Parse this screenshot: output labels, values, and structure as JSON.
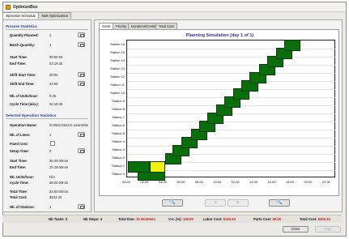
{
  "window": {
    "title": "OptimizeBox"
  },
  "main_tabs": [
    {
      "label": "Operation Schedule",
      "active": true
    },
    {
      "label": "Task Optimization",
      "active": false
    }
  ],
  "process_statistics": {
    "header": "Process Statistics",
    "rows": [
      {
        "label": "Quantity Planned:",
        "value": "1",
        "button": true
      },
      {
        "label": "Batch Quantity:",
        "value": "1",
        "button": true
      },
      {
        "label": "Start Time:",
        "value": "00:00:00"
      },
      {
        "label": "End Time:",
        "value": "02:19:45"
      },
      {
        "label": "Shift Start Time:",
        "value": "00:00",
        "button": true
      },
      {
        "label": "Shift End Time:",
        "value": "24:00",
        "button": true
      },
      {
        "label": "Nb. of Units/hour:",
        "value": "0.25"
      },
      {
        "label": "Cycle Time (min.):",
        "value": "02:19:45"
      }
    ]
  },
  "selected_operation": {
    "header": "Selected Operation Statistics",
    "rows": [
      {
        "label": "Operation Name:",
        "value": "O-0002 Electric assemble"
      },
      {
        "label": "Nb. of Lines:",
        "value": "1",
        "button": true
      },
      {
        "label": "Fixed Cost:",
        "value": "",
        "checkbox": true
      },
      {
        "label": "Setup Time:",
        "value": "0",
        "button": true
      },
      {
        "label": "Start Time:",
        "value": "25:49.00min"
      },
      {
        "label": "End Time:",
        "value": "1h 29.00min"
      },
      {
        "label": "Nb. Units/hour:",
        "value": "N/A"
      },
      {
        "label": "Cycle Time:",
        "value": "06:00.00min"
      },
      {
        "label": "Total Time:",
        "value": "24:00.00min"
      },
      {
        "label": "Total Cost:",
        "value": "$103.33"
      },
      {
        "label": "Nb. of Stations:",
        "value": "1",
        "button": true
      }
    ]
  },
  "chart_tabs": [
    {
      "label": "Gantt",
      "active": true
    },
    {
      "label": "Priority",
      "active": false
    },
    {
      "label": "Durations/Costs",
      "active": false
    },
    {
      "label": "Total Cost",
      "active": false
    }
  ],
  "chart_data": {
    "type": "bar",
    "title": "Planning Simulation (day 1 of 1)",
    "y_categories": [
      "Station 0",
      "Station 1",
      "Station 2",
      "Station 3",
      "Station 4",
      "Station 5",
      "Station 6",
      "Station 7",
      "Station 8",
      "Station 9",
      "Station 10",
      "Station 11",
      "Station 12",
      "Station 13",
      "Station 14",
      "Station 15",
      "Station 16"
    ],
    "x_ticks": [
      "00:00",
      "02:00",
      "04:00",
      "06:00",
      "08:00",
      "10:00",
      "12:00",
      "14:00",
      "16:00",
      "18:00",
      "20:00",
      "22:00"
    ],
    "x_range_hours": [
      0,
      23
    ],
    "bars": [
      {
        "row": 0,
        "start": 1.2,
        "end": 4.2,
        "color": "#0a6e0a"
      },
      {
        "row": 1,
        "start": 0.1,
        "end": 2.5,
        "color": "#0a6e0a"
      },
      {
        "row": 1,
        "start": 2.5,
        "end": 4.2,
        "color": "#f2f20e"
      },
      {
        "row": 2,
        "start": 4.2,
        "end": 6.0,
        "color": "#0a6e0a"
      },
      {
        "row": 3,
        "start": 5.0,
        "end": 6.9,
        "color": "#0a6e0a"
      },
      {
        "row": 4,
        "start": 6.0,
        "end": 7.8,
        "color": "#0a6e0a"
      },
      {
        "row": 5,
        "start": 7.0,
        "end": 8.8,
        "color": "#0a6e0a"
      },
      {
        "row": 6,
        "start": 7.9,
        "end": 9.7,
        "color": "#0a6e0a"
      },
      {
        "row": 7,
        "start": 8.8,
        "end": 10.6,
        "color": "#0a6e0a"
      },
      {
        "row": 8,
        "start": 9.8,
        "end": 11.6,
        "color": "#0a6e0a"
      },
      {
        "row": 9,
        "start": 10.7,
        "end": 12.5,
        "color": "#0a6e0a"
      },
      {
        "row": 10,
        "start": 11.7,
        "end": 13.5,
        "color": "#0a6e0a"
      },
      {
        "row": 11,
        "start": 12.6,
        "end": 14.4,
        "color": "#0a6e0a"
      },
      {
        "row": 12,
        "start": 13.5,
        "end": 15.3,
        "color": "#0a6e0a"
      },
      {
        "row": 13,
        "start": 14.5,
        "end": 16.3,
        "color": "#0a6e0a"
      },
      {
        "row": 14,
        "start": 15.4,
        "end": 17.2,
        "color": "#0a6e0a"
      },
      {
        "row": 15,
        "start": 16.4,
        "end": 18.2,
        "color": "#0a6e0a"
      },
      {
        "row": 16,
        "start": 17.3,
        "end": 19.1,
        "color": "#0a6e0a"
      }
    ],
    "grid": true
  },
  "zoom_buttons": [
    {
      "icon": "zoom-in-icon",
      "glyph": "🔍",
      "enabled": true
    },
    {
      "icon": "arrow-left-icon",
      "glyph": "◂",
      "enabled": false
    },
    {
      "icon": "arrow-right-icon",
      "glyph": "▸",
      "enabled": false
    },
    {
      "icon": "zoom-out-icon",
      "glyph": "🔍",
      "enabled": true
    }
  ],
  "status": {
    "tasks_label": "Nb Tasks:",
    "tasks_value": "2",
    "steps_label": "Nb Steps:",
    "steps_value": "4",
    "total_time_label": "Total time:",
    "total_time_value": "1h 50.00min",
    "va_label": "V.A. (%):",
    "va_value": "100.00",
    "labor_cost_label": "Labor Cost:",
    "labor_cost_value": "$103.33",
    "parts_cost_label": "Parts Cost:",
    "parts_cost_value": "$0.00",
    "total_cost_label": "Total Cost:",
    "total_cost_value": "$103.33"
  },
  "bottom_buttons": {
    "close_label": "Close",
    "apply_label": "Apply"
  }
}
